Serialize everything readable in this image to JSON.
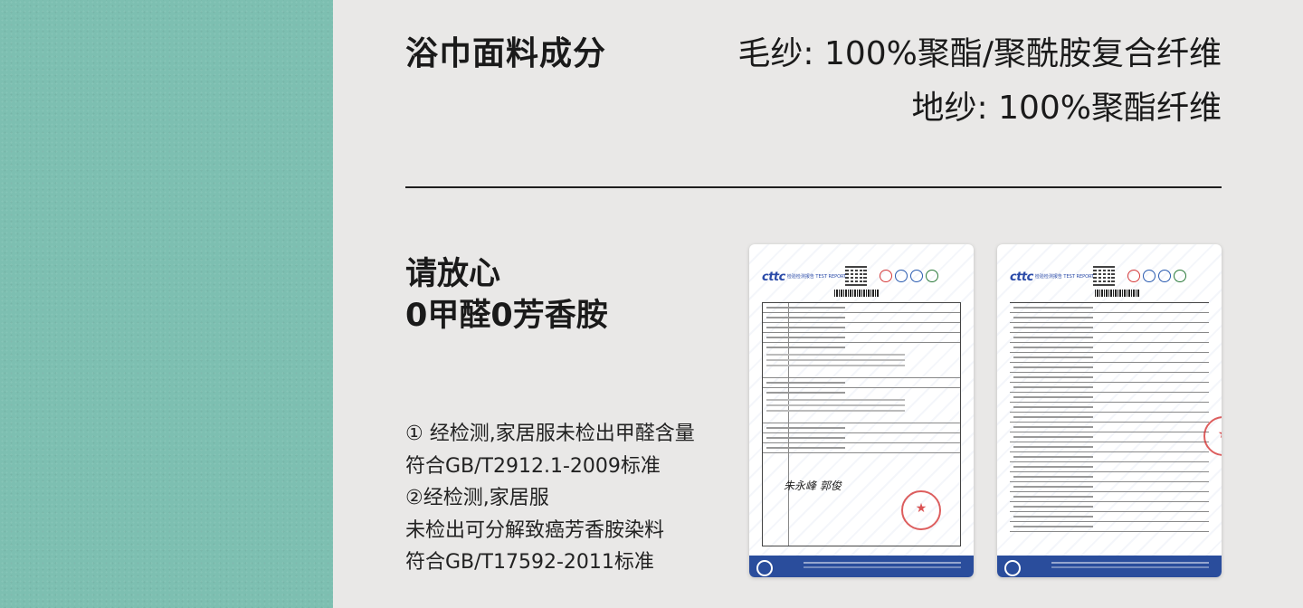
{
  "fabric": {
    "label": "浴巾面料成分",
    "pile": "毛纱: 100%聚酯/聚酰胺复合纤维",
    "ground": "地纱: 100%聚酯纤维"
  },
  "assurance": {
    "line1": "请放心",
    "line2": "0甲醛0芳香胺"
  },
  "notes": [
    "① 经检测,家居服未检出甲醛含量",
    "符合GB/T2912.1-2009标准",
    "②经检测,家居服",
    "未检出可分解致癌芳香胺染料",
    "符合GB/T17592-2011标准"
  ],
  "reports": [
    {
      "logo": "cttc",
      "logo_sub": "检验检测报告 TEST REPORT",
      "signature": "朱永峰 郭俊"
    },
    {
      "logo": "cttc",
      "logo_sub": "检验检测报告 TEST REPORT"
    }
  ],
  "colors": {
    "swatch": "#7dbfb1",
    "panel_bg": "#e9e8e7",
    "report_footer": "#2a4d9c",
    "stamp": "#d22828"
  }
}
